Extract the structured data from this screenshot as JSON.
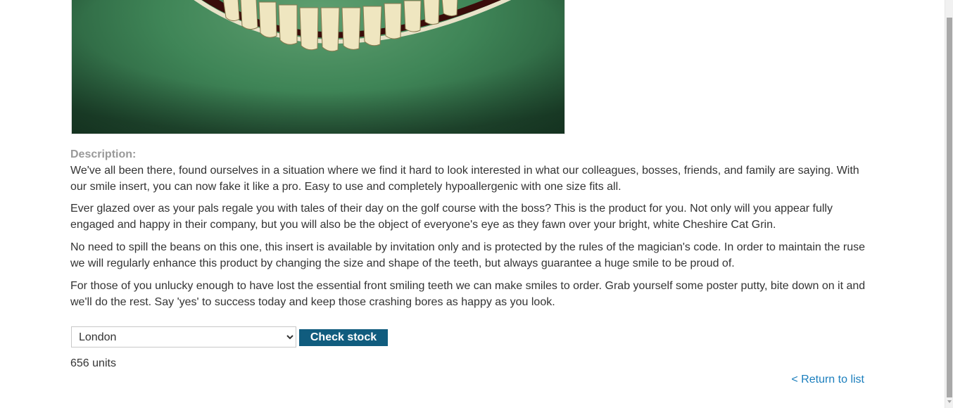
{
  "product": {
    "image_alt": "product image",
    "description_label": "Description:",
    "description_paragraphs": [
      "We've all been there, found ourselves in a situation where we find it hard to look interested in what our colleagues, bosses, friends, and family are saying. With our smile insert, you can now fake it like a pro. Easy to use and completely hypoallergenic with one size fits all.",
      "Ever glazed over as your pals regale you with tales of their day on the golf course with the boss? This is the product for you. Not only will you appear fully engaged and happy in their company, but you will also be the object of everyone's eye as they fawn over your bright, white Cheshire Cat Grin.",
      "No need to spill the beans on this one, this insert is available by invitation only and is protected by the rules of the magician's code. In order to maintain the ruse we will regularly enhance this product by changing the size and shape of the teeth, but always guarantee a huge smile to be proud of.",
      "For those of you unlucky enough to have lost the essential front smiling teeth we can make smiles to order. Grab yourself some poster putty, bite down on it and we'll do the rest. Say 'yes' to success today and keep those crashing bores as happy as you look."
    ]
  },
  "stock_check": {
    "selected_store": "London",
    "button_label": "Check stock",
    "result": "656 units"
  },
  "navigation": {
    "return_link": "< Return to list"
  },
  "colors": {
    "button_bg": "#105c7e",
    "link": "#1a7ebd",
    "label": "#999999"
  }
}
